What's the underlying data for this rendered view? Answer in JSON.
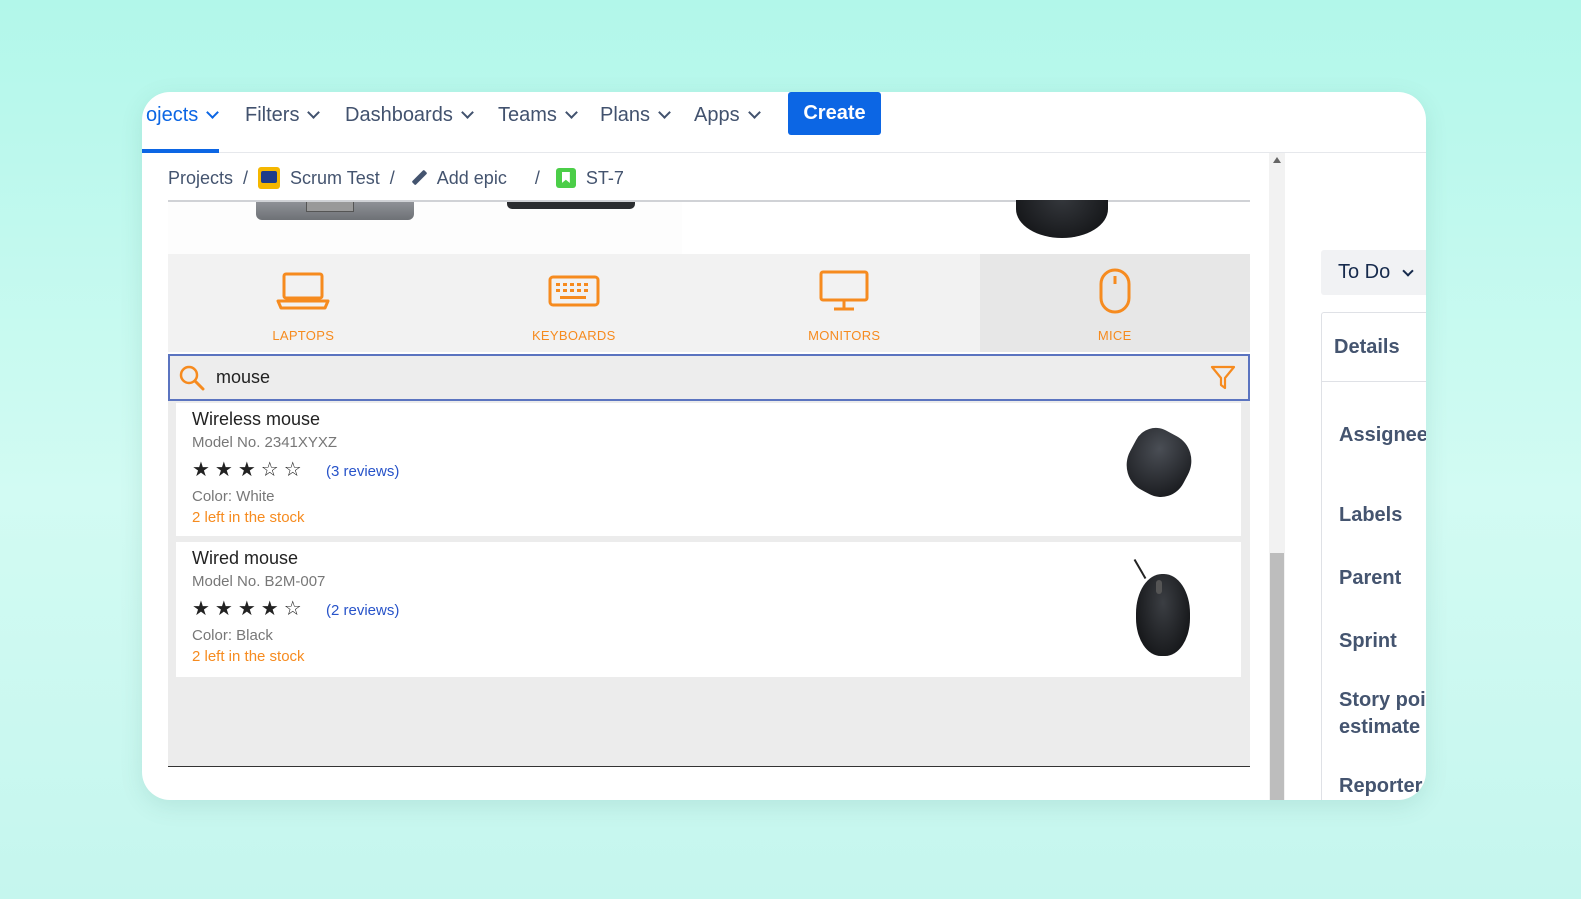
{
  "nav": {
    "items": [
      {
        "label": "ojects",
        "active": true
      },
      {
        "label": "Filters"
      },
      {
        "label": "Dashboards"
      },
      {
        "label": "Teams"
      },
      {
        "label": "Plans"
      },
      {
        "label": "Apps"
      }
    ],
    "create_label": "Create",
    "accent": "#0c66e4"
  },
  "breadcrumb": {
    "projects": "Projects",
    "project": "Scrum Test",
    "epic": "Add epic",
    "issue": "ST-7",
    "separator": "/"
  },
  "shop": {
    "categories": [
      {
        "label": "LAPTOPS",
        "icon": "laptop-icon"
      },
      {
        "label": "KEYBOARDS",
        "icon": "keyboard-icon"
      },
      {
        "label": "MONITORS",
        "icon": "monitor-icon"
      },
      {
        "label": "MICE",
        "icon": "mouse-icon",
        "selected": true
      }
    ],
    "search": {
      "value": "mouse",
      "icon": "search-icon",
      "filter_icon": "filter-icon"
    },
    "accent": "#f68b1f",
    "products": [
      {
        "name": "Wireless mouse",
        "model": "Model No. 2341XYXZ",
        "rating": 3,
        "stars": "★★★☆☆",
        "reviews": "(3 reviews)",
        "color": "Color: White",
        "stock": "2 left in the stock"
      },
      {
        "name": "Wired mouse",
        "model": "Model No. B2M-007",
        "rating": 4,
        "stars": "★★★★☆",
        "reviews": "(2 reviews)",
        "color": "Color: Black",
        "stock": "2 left in the stock"
      }
    ]
  },
  "sidebar": {
    "status": "To Do",
    "details_title": "Details",
    "fields": [
      "Assignee",
      "Labels",
      "Parent",
      "Sprint",
      "Story poir",
      "estimate",
      "Reporter"
    ]
  }
}
